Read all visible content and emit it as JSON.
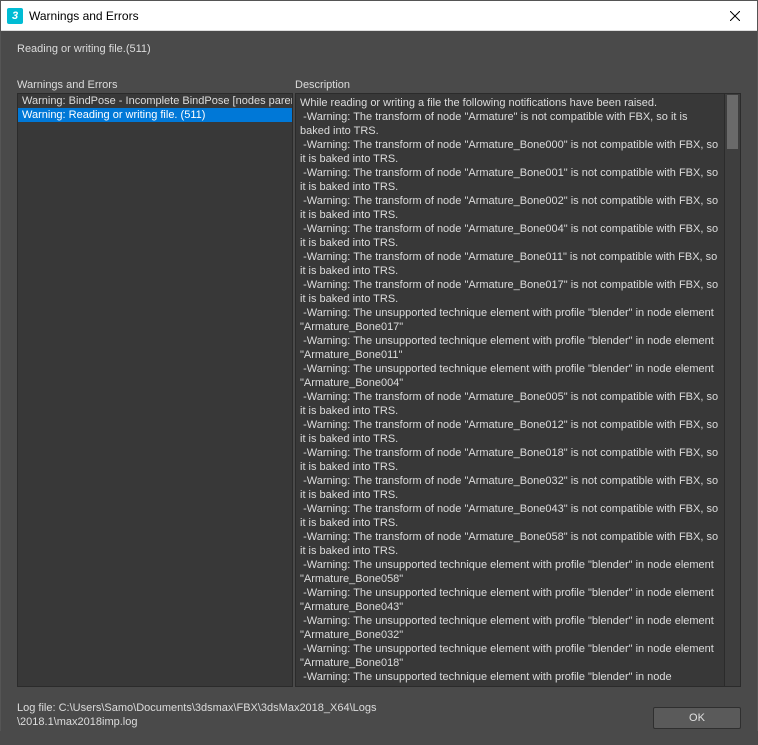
{
  "window": {
    "title": "Warnings and Errors",
    "icon_text": "3"
  },
  "status": "Reading or writing file.(511)",
  "left_panel": {
    "label": "Warnings and Errors",
    "items": [
      {
        "text": "Warning: BindPose - Incomplete BindPose [nodes paren",
        "selected": false
      },
      {
        "text": "Warning: Reading or writing file. (511)",
        "selected": true
      }
    ]
  },
  "right_panel": {
    "label": "Description",
    "text": "While reading or writing a file the following notifications have been raised.\n -Warning: The transform of node \"Armature\" is not compatible with FBX, so it is baked into TRS.\n -Warning: The transform of node \"Armature_Bone000\" is not compatible with FBX, so it is baked into TRS.\n -Warning: The transform of node \"Armature_Bone001\" is not compatible with FBX, so it is baked into TRS.\n -Warning: The transform of node \"Armature_Bone002\" is not compatible with FBX, so it is baked into TRS.\n -Warning: The transform of node \"Armature_Bone004\" is not compatible with FBX, so it is baked into TRS.\n -Warning: The transform of node \"Armature_Bone011\" is not compatible with FBX, so it is baked into TRS.\n -Warning: The transform of node \"Armature_Bone017\" is not compatible with FBX, so it is baked into TRS.\n -Warning: The unsupported technique element with profile \"blender\" in node element \"Armature_Bone017\"\n -Warning: The unsupported technique element with profile \"blender\" in node element \"Armature_Bone011\"\n -Warning: The unsupported technique element with profile \"blender\" in node element \"Armature_Bone004\"\n -Warning: The transform of node \"Armature_Bone005\" is not compatible with FBX, so it is baked into TRS.\n -Warning: The transform of node \"Armature_Bone012\" is not compatible with FBX, so it is baked into TRS.\n -Warning: The transform of node \"Armature_Bone018\" is not compatible with FBX, so it is baked into TRS.\n -Warning: The transform of node \"Armature_Bone032\" is not compatible with FBX, so it is baked into TRS.\n -Warning: The transform of node \"Armature_Bone043\" is not compatible with FBX, so it is baked into TRS.\n -Warning: The transform of node \"Armature_Bone058\" is not compatible with FBX, so it is baked into TRS.\n -Warning: The unsupported technique element with profile \"blender\" in node element \"Armature_Bone058\"\n -Warning: The unsupported technique element with profile \"blender\" in node element \"Armature_Bone043\"\n -Warning: The unsupported technique element with profile \"blender\" in node element \"Armature_Bone032\"\n -Warning: The unsupported technique element with profile \"blender\" in node element \"Armature_Bone018\"\n -Warning: The unsupported technique element with profile \"blender\" in node"
  },
  "footer": {
    "log_file_line1": "Log file: C:\\Users\\Samo\\Documents\\3dsmax\\FBX\\3dsMax2018_X64\\Logs",
    "log_file_line2": "\\2018.1\\max2018imp.log",
    "ok_label": "OK"
  }
}
